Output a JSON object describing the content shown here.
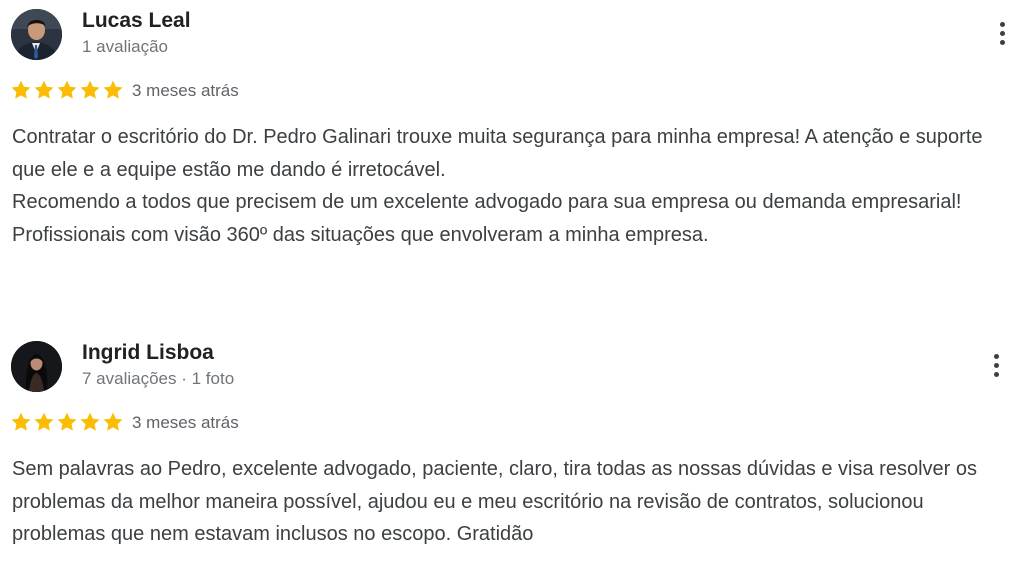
{
  "colors": {
    "star": "#fbbc04",
    "author_text": "#202124",
    "meta_text": "#70757a",
    "body_text": "#3c4043"
  },
  "reviews": [
    {
      "author": "Lucas Leal",
      "meta": "1 avaliação",
      "rating": 5,
      "time": "3 meses atrás",
      "lines": [
        "Contratar o escritório do Dr. Pedro Galinari trouxe muita segurança para minha empresa! A atenção e suporte que ele e a equipe estão me dando é irretocável.",
        "Recomendo a todos que precisem de um excelente advogado para sua empresa ou demanda empresarial!",
        "Profissionais com visão 360º das situações que envolveram a minha empresa."
      ],
      "menu_icon": "more-vert-icon"
    },
    {
      "author": "Ingrid Lisboa",
      "meta": "7 avaliações · 1 foto",
      "rating": 5,
      "time": "3 meses atrás",
      "lines": [
        "Sem palavras ao Pedro, excelente advogado, paciente, claro, tira todas as nossas dúvidas e visa resolver os problemas da melhor maneira possível, ajudou eu e meu escritório na revisão de contratos, solucionou problemas que nem estavam inclusos no escopo. Gratidão"
      ],
      "menu_icon": "more-vert-icon"
    }
  ]
}
